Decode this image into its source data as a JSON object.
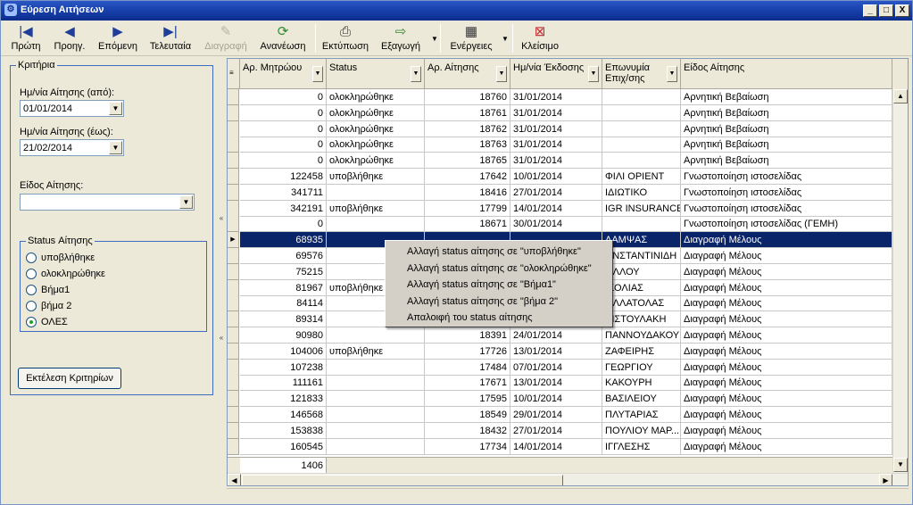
{
  "window": {
    "title": "Εύρεση Αιτήσεων",
    "controls": {
      "minimize": "_",
      "maximize": "□",
      "close": "X"
    }
  },
  "toolbar": {
    "first": {
      "label": "Πρώτη",
      "icon": "first-record-icon",
      "glyph": "|◀"
    },
    "prev": {
      "label": "Προηγ.",
      "icon": "previous-icon",
      "glyph": "◀"
    },
    "next": {
      "label": "Επόμενη",
      "icon": "next-icon",
      "glyph": "▶"
    },
    "last": {
      "label": "Τελευταία",
      "icon": "last-record-icon",
      "glyph": "▶|"
    },
    "delete": {
      "label": "Διαγραφή",
      "icon": "eraser-icon",
      "glyph": "✎",
      "enabled": false
    },
    "refresh": {
      "label": "Ανανέωση",
      "icon": "refresh-icon",
      "glyph": "⟳"
    },
    "print": {
      "label": "Εκτύπωση",
      "icon": "printer-icon",
      "glyph": "⎙"
    },
    "export": {
      "label": "Εξαγωγή",
      "icon": "export-icon",
      "glyph": "⇨"
    },
    "actions": {
      "label": "Ενέργειες",
      "icon": "grid-actions-icon",
      "glyph": "▦"
    },
    "close": {
      "label": "Κλείσιμο",
      "icon": "close-form-icon",
      "glyph": "⊠"
    },
    "dropdown_glyph": "▼"
  },
  "criteria": {
    "legend": "Κριτήρια",
    "date_from": {
      "label": "Ημ/νία Αίτησης (από):",
      "value": "01/01/2014"
    },
    "date_to": {
      "label": "Ημ/νία Αίτησης (έως):",
      "value": "21/02/2014"
    },
    "request_type": {
      "label": "Είδος Αίτησης:",
      "value": ""
    },
    "status_group": {
      "legend": "Status Αίτησης",
      "options": [
        "υποβλήθηκε",
        "ολοκληρώθηκε",
        "Βήμα1",
        "βήμα 2",
        "ΟΛΕΣ"
      ],
      "selected": "ΟΛΕΣ"
    },
    "run_button": "Εκτέλεση Κριτηρίων"
  },
  "grid": {
    "columns": [
      "Αρ. Μητρώου",
      "Status",
      "Αρ. Αίτησης",
      "Ημ/νία Έκδοσης",
      "Επωνυμία Επιχ/σης",
      "Είδος Αίτησης"
    ],
    "rows": [
      [
        "0",
        "ολοκληρώθηκε",
        "18760",
        "31/01/2014",
        "",
        "Αρνητική Βεβαίωση"
      ],
      [
        "0",
        "ολοκληρώθηκε",
        "18761",
        "31/01/2014",
        "",
        "Αρνητική Βεβαίωση"
      ],
      [
        "0",
        "ολοκληρώθηκε",
        "18762",
        "31/01/2014",
        "",
        "Αρνητική Βεβαίωση"
      ],
      [
        "0",
        "ολοκληρώθηκε",
        "18763",
        "31/01/2014",
        "",
        "Αρνητική Βεβαίωση"
      ],
      [
        "0",
        "ολοκληρώθηκε",
        "18765",
        "31/01/2014",
        "",
        "Αρνητική Βεβαίωση"
      ],
      [
        "122458",
        "υποβλήθηκε",
        "17642",
        "10/01/2014",
        "ΦΙΛΙ ΟΡΙΕΝΤ",
        "Γνωστοποίηση ιστοσελίδας"
      ],
      [
        "341711",
        "",
        "18416",
        "27/01/2014",
        "ΙΔΙΩΤΙΚΟ",
        "Γνωστοποίηση ιστοσελίδας"
      ],
      [
        "342191",
        "υποβλήθηκε",
        "17799",
        "14/01/2014",
        "IGR INSURANCE",
        "Γνωστοποίηση ιστοσελίδας"
      ],
      [
        "0",
        "",
        "18671",
        "30/01/2014",
        "",
        "Γνωστοποίηση ιστοσελίδας (ΓΕΜΗ)"
      ],
      [
        "68935",
        "",
        "",
        "",
        "ΛΑΜΨΑΣ",
        "Διαγραφή Μέλους"
      ],
      [
        "69576",
        "",
        "",
        "",
        "ΩΝΣΤΑΝΤΙΝΙΔΗ",
        "Διαγραφή Μέλους"
      ],
      [
        "75215",
        "",
        "",
        "",
        "ΈΛΛΟΥ",
        "Διαγραφή Μέλους"
      ],
      [
        "81967",
        "υποβλήθηκε",
        "",
        "",
        "ΙΚΟΛΙΑΣ",
        "Διαγραφή Μέλους"
      ],
      [
        "84114",
        "",
        "",
        "",
        "ΈΛΛΑΤΟΛΑΣ",
        "Διαγραφή Μέλους"
      ],
      [
        "89314",
        "",
        "",
        "",
        "ΡΙΣΤΟΥΛΑΚΗ",
        "Διαγραφή Μέλους"
      ],
      [
        "90980",
        "",
        "18391",
        "24/01/2014",
        "ΠΑΝΝΟΥΔΑΚΟΥ",
        "Διαγραφή Μέλους"
      ],
      [
        "104006",
        "υποβλήθηκε",
        "17726",
        "13/01/2014",
        "ΖΑΦΕΙΡΗΣ",
        "Διαγραφή Μέλους"
      ],
      [
        "107238",
        "",
        "17484",
        "07/01/2014",
        "ΓΕΩΡΓΙΟΥ",
        "Διαγραφή Μέλους"
      ],
      [
        "111161",
        "",
        "17671",
        "13/01/2014",
        "ΚΑΚΟΥΡΗ",
        "Διαγραφή Μέλους"
      ],
      [
        "121833",
        "",
        "17595",
        "10/01/2014",
        "ΒΑΣΙΛΕΙΟΥ",
        "Διαγραφή Μέλους"
      ],
      [
        "146568",
        "",
        "18549",
        "29/01/2014",
        "ΠΛΥΤΑΡΙΑΣ",
        "Διαγραφή Μέλους"
      ],
      [
        "153838",
        "",
        "18432",
        "27/01/2014",
        "ΠΟΥΛΙΟΥ ΜΑΡ...",
        "Διαγραφή Μέλους"
      ],
      [
        "160545",
        "",
        "17734",
        "14/01/2014",
        "ΙΓΓΛΕΣΗΣ",
        "Διαγραφή Μέλους"
      ]
    ],
    "selected_row": 9,
    "footer_total": "1406"
  },
  "context_menu": {
    "items": [
      "Αλλαγή status αίτησης σε \"υποβλήθηκε\"",
      "Αλλαγή status αίτησης σε \"ολοκληρώθηκε\"",
      "Αλλαγή status αίτησης σε \"Βήμα1\"",
      "Αλλαγή status αίτησης σε \"βήμα 2\"",
      "Απαλοιφή του status αίτησης"
    ]
  }
}
